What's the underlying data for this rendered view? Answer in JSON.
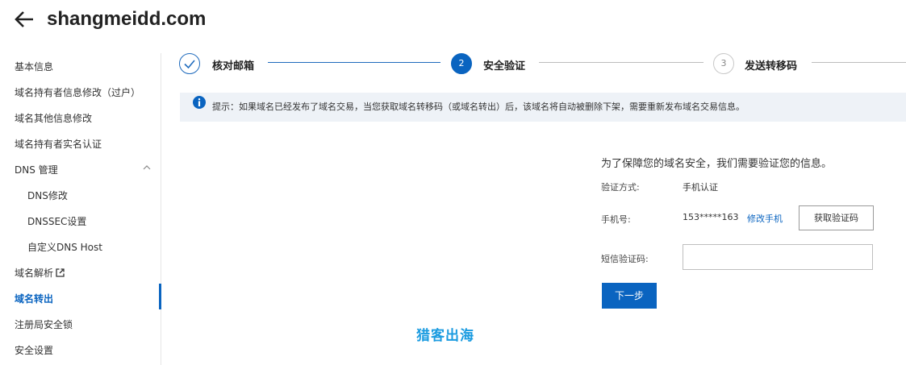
{
  "header": {
    "title": "shangmeidd.com"
  },
  "sidebar": {
    "items": [
      {
        "label": "基本信息"
      },
      {
        "label": "域名持有者信息修改（过户）"
      },
      {
        "label": "域名其他信息修改"
      },
      {
        "label": "域名持有者实名认证"
      },
      {
        "label": "DNS 管理"
      },
      {
        "label": "DNS修改"
      },
      {
        "label": "DNSSEC设置"
      },
      {
        "label": "自定义DNS Host"
      },
      {
        "label": "域名解析"
      },
      {
        "label": "域名转出"
      },
      {
        "label": "注册局安全锁"
      },
      {
        "label": "安全设置"
      }
    ]
  },
  "steps": [
    {
      "number": "1",
      "label": "核对邮箱",
      "state": "done"
    },
    {
      "number": "2",
      "label": "安全验证",
      "state": "current"
    },
    {
      "number": "3",
      "label": "发送转移码",
      "state": "todo"
    }
  ],
  "notice": {
    "text": "提示：如果域名已经发布了域名交易，当您获取域名转移码（或域名转出）后，该域名将自动被删除下架，需要重新发布域名交易信息。"
  },
  "form": {
    "intro": "为了保障您的域名安全，我们需要验证您的信息。",
    "method_label": "验证方式:",
    "method_value": "手机认证",
    "phone_label": "手机号:",
    "phone_value": "153*****163",
    "change_phone": "修改手机",
    "get_code": "获取验证码",
    "sms_label": "短信验证码:",
    "sms_value": "",
    "next": "下一步"
  },
  "watermark": "猎客出海",
  "colors": {
    "accent": "#0a64c0",
    "notice_bg": "#eef2f7",
    "watermark": "#1a9be0"
  }
}
